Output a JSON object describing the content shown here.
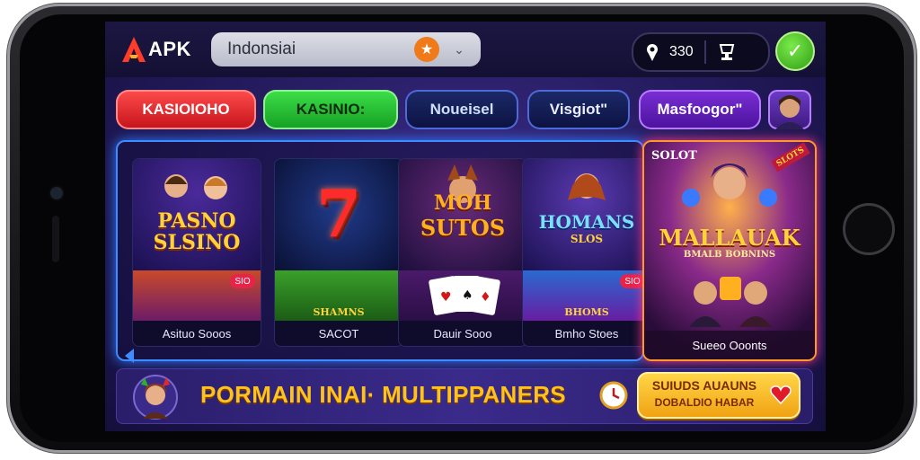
{
  "header": {
    "logo_text": "APK",
    "language_value": "Indonsiai",
    "stat_value": "330",
    "colors": {
      "accent": "#f07a1a",
      "ok": "#2f9e16"
    }
  },
  "tabs": [
    {
      "label": "KASIOIOHO"
    },
    {
      "label": "KASINIO:"
    },
    {
      "label": "Noueisel"
    },
    {
      "label": "Visgiot\""
    },
    {
      "label": "Masfoogor\""
    }
  ],
  "games": [
    {
      "title_line1": "PASNO",
      "title_line2": "SLSINO",
      "badge": "",
      "label": "Asituo Sooos"
    },
    {
      "title_line1": "7",
      "title_line2": "",
      "badge": "",
      "label": "SACOT"
    },
    {
      "title_line1": "MOH",
      "title_line2": "SUTOS",
      "badge": "",
      "label": "Dauir Sooo"
    },
    {
      "title_line1": "HOMANS",
      "title_line2": "SLOS",
      "badge": "",
      "label": "Bmho Stoes"
    }
  ],
  "thumb_badges": [
    "SIO",
    "",
    "",
    "SIO"
  ],
  "thumb_titles": [
    "",
    "SHAMNS",
    "",
    "BHOMS"
  ],
  "feature": {
    "tag": "SOLOT",
    "title": "MALLAUAK",
    "subtitle": "BMALB BOBNINS",
    "label": "Sueeo Ooonts",
    "corner": "SLOTS"
  },
  "banner": {
    "text": "PORMAIN INAI· MULTIPPANERS",
    "button_line1": "SUIUDS AUAUNS",
    "button_line2": "DOBALDIO HABAR"
  }
}
